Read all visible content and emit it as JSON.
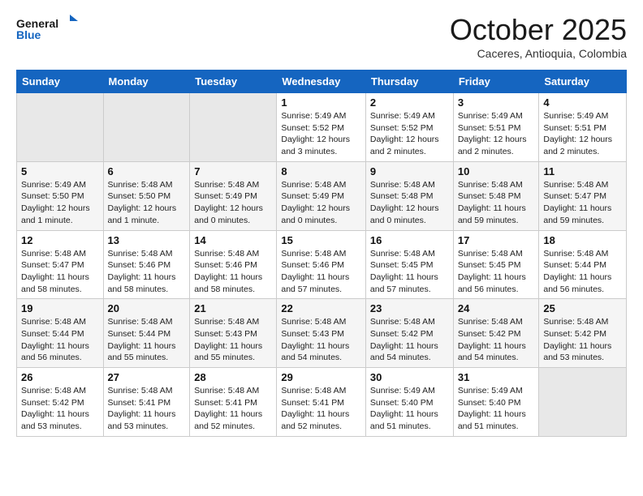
{
  "header": {
    "logo_line1": "General",
    "logo_line2": "Blue",
    "month": "October 2025",
    "location": "Caceres, Antioquia, Colombia"
  },
  "weekdays": [
    "Sunday",
    "Monday",
    "Tuesday",
    "Wednesday",
    "Thursday",
    "Friday",
    "Saturday"
  ],
  "weeks": [
    [
      {
        "day": "",
        "info": ""
      },
      {
        "day": "",
        "info": ""
      },
      {
        "day": "",
        "info": ""
      },
      {
        "day": "1",
        "info": "Sunrise: 5:49 AM\nSunset: 5:52 PM\nDaylight: 12 hours\nand 3 minutes."
      },
      {
        "day": "2",
        "info": "Sunrise: 5:49 AM\nSunset: 5:52 PM\nDaylight: 12 hours\nand 2 minutes."
      },
      {
        "day": "3",
        "info": "Sunrise: 5:49 AM\nSunset: 5:51 PM\nDaylight: 12 hours\nand 2 minutes."
      },
      {
        "day": "4",
        "info": "Sunrise: 5:49 AM\nSunset: 5:51 PM\nDaylight: 12 hours\nand 2 minutes."
      }
    ],
    [
      {
        "day": "5",
        "info": "Sunrise: 5:49 AM\nSunset: 5:50 PM\nDaylight: 12 hours\nand 1 minute."
      },
      {
        "day": "6",
        "info": "Sunrise: 5:48 AM\nSunset: 5:50 PM\nDaylight: 12 hours\nand 1 minute."
      },
      {
        "day": "7",
        "info": "Sunrise: 5:48 AM\nSunset: 5:49 PM\nDaylight: 12 hours\nand 0 minutes."
      },
      {
        "day": "8",
        "info": "Sunrise: 5:48 AM\nSunset: 5:49 PM\nDaylight: 12 hours\nand 0 minutes."
      },
      {
        "day": "9",
        "info": "Sunrise: 5:48 AM\nSunset: 5:48 PM\nDaylight: 12 hours\nand 0 minutes."
      },
      {
        "day": "10",
        "info": "Sunrise: 5:48 AM\nSunset: 5:48 PM\nDaylight: 11 hours\nand 59 minutes."
      },
      {
        "day": "11",
        "info": "Sunrise: 5:48 AM\nSunset: 5:47 PM\nDaylight: 11 hours\nand 59 minutes."
      }
    ],
    [
      {
        "day": "12",
        "info": "Sunrise: 5:48 AM\nSunset: 5:47 PM\nDaylight: 11 hours\nand 58 minutes."
      },
      {
        "day": "13",
        "info": "Sunrise: 5:48 AM\nSunset: 5:46 PM\nDaylight: 11 hours\nand 58 minutes."
      },
      {
        "day": "14",
        "info": "Sunrise: 5:48 AM\nSunset: 5:46 PM\nDaylight: 11 hours\nand 58 minutes."
      },
      {
        "day": "15",
        "info": "Sunrise: 5:48 AM\nSunset: 5:46 PM\nDaylight: 11 hours\nand 57 minutes."
      },
      {
        "day": "16",
        "info": "Sunrise: 5:48 AM\nSunset: 5:45 PM\nDaylight: 11 hours\nand 57 minutes."
      },
      {
        "day": "17",
        "info": "Sunrise: 5:48 AM\nSunset: 5:45 PM\nDaylight: 11 hours\nand 56 minutes."
      },
      {
        "day": "18",
        "info": "Sunrise: 5:48 AM\nSunset: 5:44 PM\nDaylight: 11 hours\nand 56 minutes."
      }
    ],
    [
      {
        "day": "19",
        "info": "Sunrise: 5:48 AM\nSunset: 5:44 PM\nDaylight: 11 hours\nand 56 minutes."
      },
      {
        "day": "20",
        "info": "Sunrise: 5:48 AM\nSunset: 5:44 PM\nDaylight: 11 hours\nand 55 minutes."
      },
      {
        "day": "21",
        "info": "Sunrise: 5:48 AM\nSunset: 5:43 PM\nDaylight: 11 hours\nand 55 minutes."
      },
      {
        "day": "22",
        "info": "Sunrise: 5:48 AM\nSunset: 5:43 PM\nDaylight: 11 hours\nand 54 minutes."
      },
      {
        "day": "23",
        "info": "Sunrise: 5:48 AM\nSunset: 5:42 PM\nDaylight: 11 hours\nand 54 minutes."
      },
      {
        "day": "24",
        "info": "Sunrise: 5:48 AM\nSunset: 5:42 PM\nDaylight: 11 hours\nand 54 minutes."
      },
      {
        "day": "25",
        "info": "Sunrise: 5:48 AM\nSunset: 5:42 PM\nDaylight: 11 hours\nand 53 minutes."
      }
    ],
    [
      {
        "day": "26",
        "info": "Sunrise: 5:48 AM\nSunset: 5:42 PM\nDaylight: 11 hours\nand 53 minutes."
      },
      {
        "day": "27",
        "info": "Sunrise: 5:48 AM\nSunset: 5:41 PM\nDaylight: 11 hours\nand 53 minutes."
      },
      {
        "day": "28",
        "info": "Sunrise: 5:48 AM\nSunset: 5:41 PM\nDaylight: 11 hours\nand 52 minutes."
      },
      {
        "day": "29",
        "info": "Sunrise: 5:48 AM\nSunset: 5:41 PM\nDaylight: 11 hours\nand 52 minutes."
      },
      {
        "day": "30",
        "info": "Sunrise: 5:49 AM\nSunset: 5:40 PM\nDaylight: 11 hours\nand 51 minutes."
      },
      {
        "day": "31",
        "info": "Sunrise: 5:49 AM\nSunset: 5:40 PM\nDaylight: 11 hours\nand 51 minutes."
      },
      {
        "day": "",
        "info": ""
      }
    ]
  ]
}
